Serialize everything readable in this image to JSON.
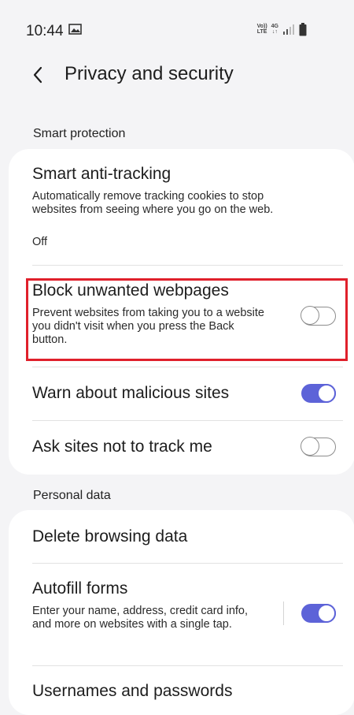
{
  "status_bar": {
    "time": "10:44",
    "volte_top": "Vo))",
    "volte_bottom": "LTE",
    "network_top": "4G",
    "network_bottom": "↓↑"
  },
  "header": {
    "title": "Privacy and security"
  },
  "smart_protection": {
    "section_title": "Smart protection",
    "items": [
      {
        "title": "Smart anti-tracking",
        "description": "Automatically remove tracking cookies to stop websites from seeing where you go on the web.",
        "status": "Off"
      },
      {
        "title": "Block unwanted webpages",
        "description": "Prevent websites from taking you to a website you didn't visit when you press the Back button.",
        "toggle": false
      },
      {
        "title": "Warn about malicious sites",
        "toggle": true
      },
      {
        "title": "Ask sites not to track me",
        "toggle": false
      }
    ]
  },
  "personal_data": {
    "section_title": "Personal data",
    "items": [
      {
        "title": "Delete browsing data"
      },
      {
        "title": "Autofill forms",
        "description": "Enter your name, address, credit card info, and more on websites with a single tap.",
        "toggle": true
      },
      {
        "title": "Usernames and passwords"
      }
    ]
  },
  "colors": {
    "accent": "#5d63d8",
    "highlight": "#e0202b",
    "background": "#f4f4f6",
    "card": "#ffffff"
  },
  "icons": [
    "gallery-icon",
    "signal-icon",
    "battery-icon",
    "back-icon"
  ]
}
